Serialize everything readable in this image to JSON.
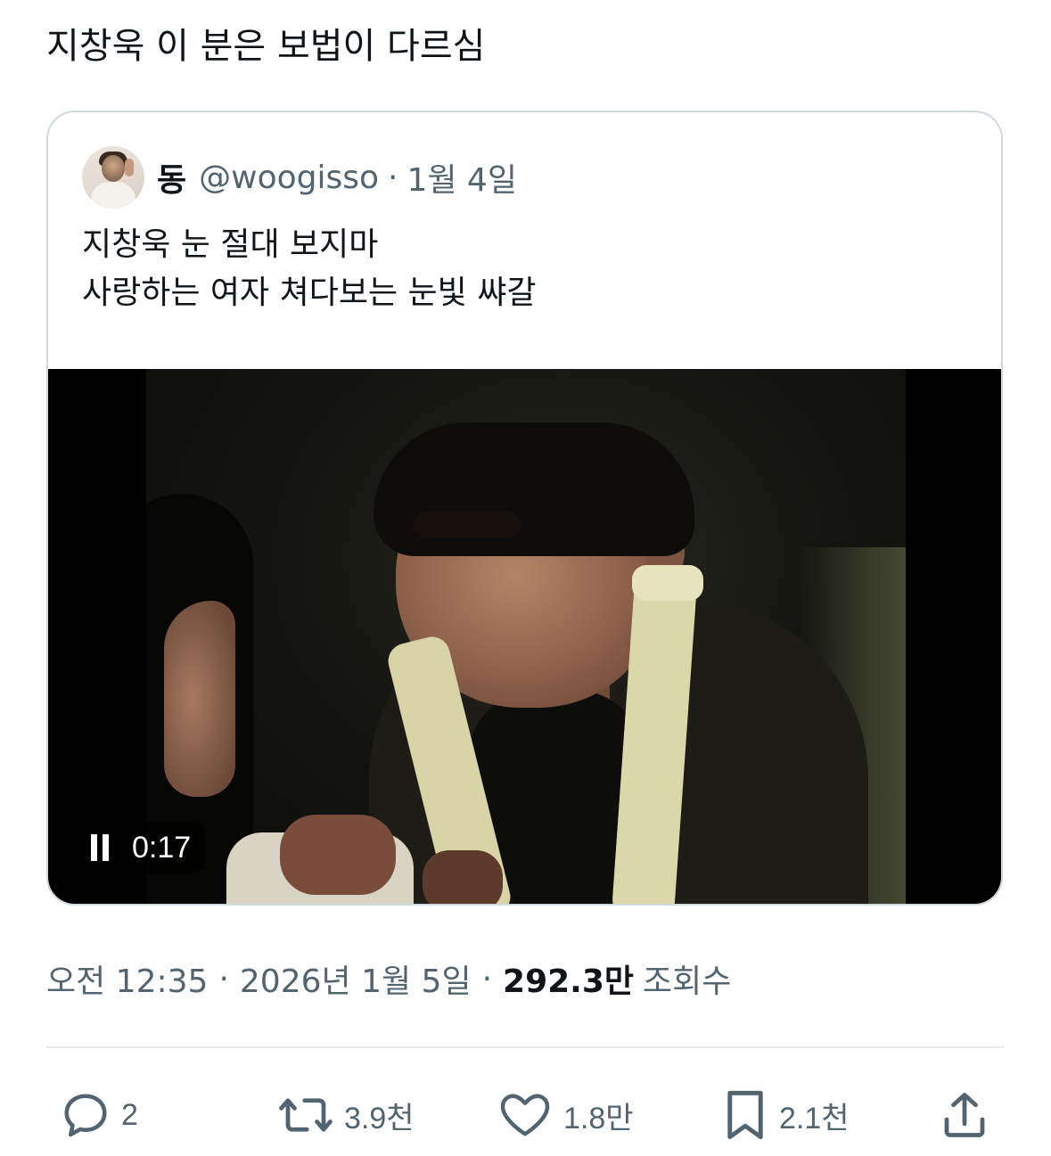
{
  "tweet": {
    "text": "지창욱 이 분은 보법이 다르심"
  },
  "quote": {
    "name": "동",
    "handle": "@woogisso",
    "separator": "·",
    "date": "1월 4일",
    "lines": [
      "지창욱 눈 절대 보지마",
      "사랑하는 여자 쳐다보는 눈빛 쌰갈"
    ],
    "video": {
      "state_icon": "pause-icon",
      "time": "0:17"
    }
  },
  "meta": {
    "time": "오전 12:35",
    "separator": "·",
    "date": "2026년 1월 5일",
    "views_num": "292.3만",
    "views_label": "조회수"
  },
  "actions": {
    "reply": {
      "icon": "reply-icon",
      "count": "2"
    },
    "retweet": {
      "icon": "retweet-icon",
      "count": "3.9천"
    },
    "like": {
      "icon": "heart-icon",
      "count": "1.8만"
    },
    "bookmark": {
      "icon": "bookmark-icon",
      "count": "2.1천"
    },
    "share": {
      "icon": "share-icon"
    }
  },
  "colors": {
    "text": "#0f1419",
    "secondary": "#536471",
    "border": "#cfd9de"
  }
}
